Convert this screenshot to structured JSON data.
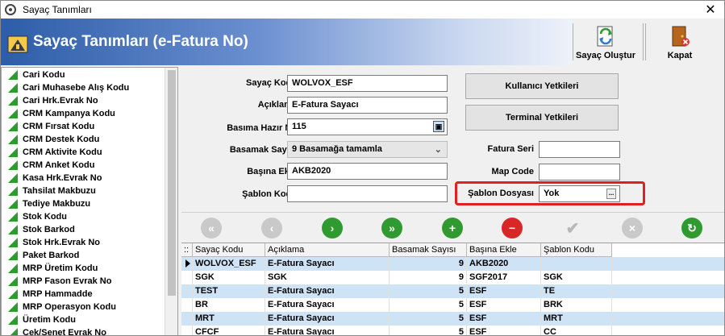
{
  "window": {
    "title": "Sayaç Tanımları",
    "close_label": "✕"
  },
  "header": {
    "title": "Sayaç Tanımları (e-Fatura No)"
  },
  "toolbar": {
    "create_label": "Sayaç Oluştur",
    "close_label": "Kapat"
  },
  "sidebar": {
    "items": [
      "Cari Kodu",
      "Cari Muhasebe Alış Kodu",
      "Cari Hrk.Evrak No",
      "CRM Kampanya Kodu",
      "CRM Fırsat Kodu",
      "CRM Destek Kodu",
      "CRM Aktivite Kodu",
      "CRM Anket Kodu",
      "Kasa Hrk.Evrak No",
      "Tahsilat Makbuzu",
      "Tediye Makbuzu",
      "Stok Kodu",
      "Stok Barkod",
      "Stok Hrk.Evrak No",
      "Paket Barkod",
      "MRP Üretim Kodu",
      "MRP Fason Evrak No",
      "MRP Hammadde",
      "MRP Operasyon Kodu",
      "Üretim Kodu",
      "Çek/Senet Evrak No"
    ]
  },
  "form": {
    "sayac_kodu_label": "Sayaç Kodu",
    "sayac_kodu_value": "WOLVOX_ESF",
    "aciklama_label": "Açıklama",
    "aciklama_value": "E-Fatura Sayacı",
    "basima_hazir_label": "Basıma Hazır No",
    "basima_hazir_value": "115",
    "basamak_label": "Basamak Sayısı",
    "basamak_value": "9 Basamağa tamamla",
    "basina_ekle_label": "Başına Ekle",
    "basina_ekle_value": "AKB2020",
    "sablon_kodu_label": "Şablon Kodu",
    "sablon_kodu_value": "",
    "fatura_seri_label": "Fatura Seri",
    "fatura_seri_value": "",
    "map_code_label": "Map Code",
    "map_code_value": "",
    "sablon_dosyasi_label": "Şablon Dosyası",
    "sablon_dosyasi_value": "Yok",
    "kullanici_btn": "Kullanıcı Yetkileri",
    "terminal_btn": "Terminal Yetkileri",
    "ellipsis": "...",
    "dropdown_chevron": "⌄"
  },
  "grid": {
    "indicator": "::",
    "headers": [
      "Sayaç Kodu",
      "Açıklama",
      "Basamak Sayısı",
      "Başına Ekle",
      "Şablon Kodu"
    ],
    "rows": [
      [
        "WOLVOX_ESF",
        "E-Fatura Sayacı",
        "9",
        "AKB2020",
        ""
      ],
      [
        "SGK",
        "SGK",
        "9",
        "SGF2017",
        "SGK"
      ],
      [
        "TEST",
        "E-Fatura Sayacı",
        "5",
        "ESF",
        "TE"
      ],
      [
        "BR",
        "E-Fatura Sayacı",
        "5",
        "ESF",
        "BRK"
      ],
      [
        "MRT",
        "E-Fatura Sayacı",
        "5",
        "ESF",
        "MRT"
      ],
      [
        "CFCF",
        "E-Fatura Sayacı",
        "5",
        "ESF",
        "CC"
      ]
    ]
  },
  "colors": {
    "highlight": "#e02020",
    "selected_row": "#cfe3f7",
    "alt_row": "#ffffff",
    "accent_green": "#2f9a2f"
  }
}
